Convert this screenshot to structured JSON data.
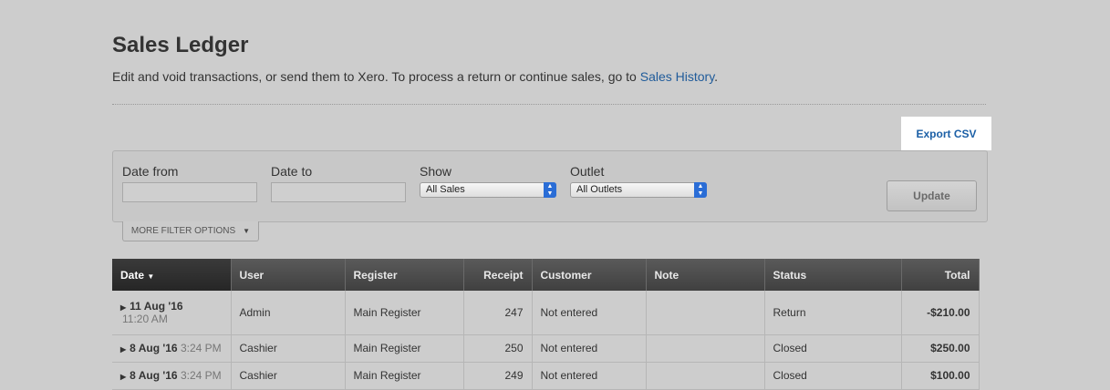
{
  "header": {
    "title": "Sales Ledger",
    "subtitle_text": "Edit and void transactions, or send them to Xero. To process a return or continue sales, go to ",
    "subtitle_link": "Sales History",
    "subtitle_end": "."
  },
  "toolbar": {
    "export_label": "Export CSV"
  },
  "filters": {
    "date_from_label": "Date from",
    "date_from_value": "",
    "date_to_label": "Date to",
    "date_to_value": "",
    "show_label": "Show",
    "show_value": "All Sales",
    "outlet_label": "Outlet",
    "outlet_value": "All Outlets",
    "update_label": "Update",
    "more_label": "MORE FILTER OPTIONS"
  },
  "table": {
    "columns": [
      "Date",
      "User",
      "Register",
      "Receipt",
      "Customer",
      "Note",
      "Status",
      "Total"
    ],
    "sort_indicator": "▼",
    "rows": [
      {
        "date": "11 Aug '16",
        "time": "11:20 AM",
        "user": "Admin",
        "register": "Main Register",
        "receipt": "247",
        "customer": "Not entered",
        "note": "",
        "status": "Return",
        "total": "-$210.00"
      },
      {
        "date": "8 Aug '16",
        "time": "3:24 PM",
        "user": "Cashier",
        "register": "Main Register",
        "receipt": "250",
        "customer": "Not entered",
        "note": "",
        "status": "Closed",
        "total": "$250.00"
      },
      {
        "date": "8 Aug '16",
        "time": "3:24 PM",
        "user": "Cashier",
        "register": "Main Register",
        "receipt": "249",
        "customer": "Not entered",
        "note": "",
        "status": "Closed",
        "total": "$100.00"
      }
    ]
  },
  "colors": {
    "link": "#1f5b9a",
    "select_arrow": "#2a6dd6",
    "header_bg": "#4a4a4a"
  }
}
